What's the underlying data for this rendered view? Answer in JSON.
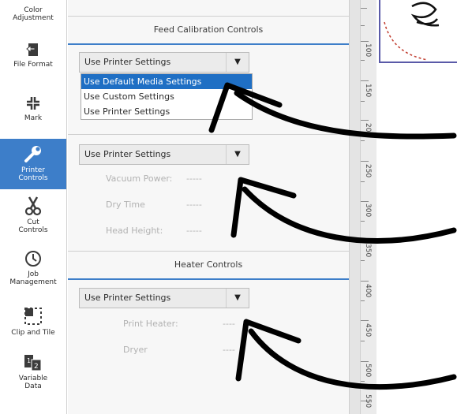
{
  "sidebar": {
    "items": [
      {
        "label_lines": [
          "Color",
          "Adjustment"
        ],
        "icon": "color-adjustment-icon"
      },
      {
        "label_lines": [
          "File Format"
        ],
        "icon": "file-format-icon"
      },
      {
        "label_lines": [
          "Mark"
        ],
        "icon": "mark-icon"
      },
      {
        "label_lines": [
          "Printer",
          "Controls"
        ],
        "icon": "wrench-icon",
        "active": true
      },
      {
        "label_lines": [
          "Cut",
          "Controls"
        ],
        "icon": "scissors-icon"
      },
      {
        "label_lines": [
          "Job",
          "Management"
        ],
        "icon": "clock-icon"
      },
      {
        "label_lines": [
          "Clip and Tile"
        ],
        "icon": "clip-tile-icon"
      },
      {
        "label_lines": [
          "Variable",
          "Data"
        ],
        "icon": "variable-data-icon"
      }
    ]
  },
  "sections": {
    "feed": {
      "title": "Feed Calibration Controls",
      "select_value": "Use Printer Settings",
      "dropdown_options": [
        "Use Default Media Settings",
        "Use Custom Settings",
        "Use Printer Settings"
      ],
      "highlighted_option": "Use Default Media Settings"
    },
    "vacuum": {
      "select_value": "Use Printer Settings",
      "fields": [
        {
          "label": "Vacuum Power:",
          "value": "-----"
        },
        {
          "label": "Dry Time",
          "value": "-----"
        },
        {
          "label": "Head Height:",
          "value": "-----"
        }
      ]
    },
    "heater": {
      "title": "Heater Controls",
      "select_value": "Use Printer Settings",
      "fields": [
        {
          "label": "Print Heater:",
          "value": "----"
        },
        {
          "label": "Dryer",
          "value": "----"
        }
      ]
    }
  },
  "ruler": {
    "labels": [
      "100",
      "150",
      "200",
      "250",
      "300",
      "350",
      "400",
      "450",
      "500",
      "550"
    ]
  },
  "colors": {
    "accent": "#3d7ec9",
    "highlight": "#1f6fc4",
    "artboard_border": "#5a5aa8",
    "arrow": "#000000"
  }
}
